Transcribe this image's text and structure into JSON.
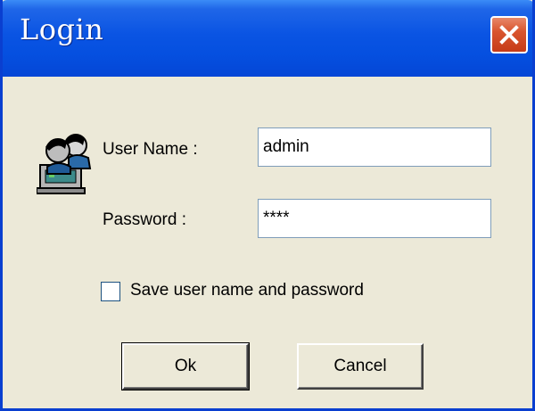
{
  "window": {
    "title": "Login"
  },
  "form": {
    "username_label": "User Name :",
    "username_value": "admin",
    "password_label": "Password :",
    "password_value": "****",
    "save_label": "Save user name and password",
    "save_checked": false
  },
  "buttons": {
    "ok_label": "Ok",
    "cancel_label": "Cancel"
  },
  "icons": {
    "window": "users-computer-icon",
    "close": "close-icon"
  },
  "colors": {
    "titlebar": "#0a54e3",
    "close": "#d9552e",
    "dialog_bg": "#ece9d8"
  }
}
